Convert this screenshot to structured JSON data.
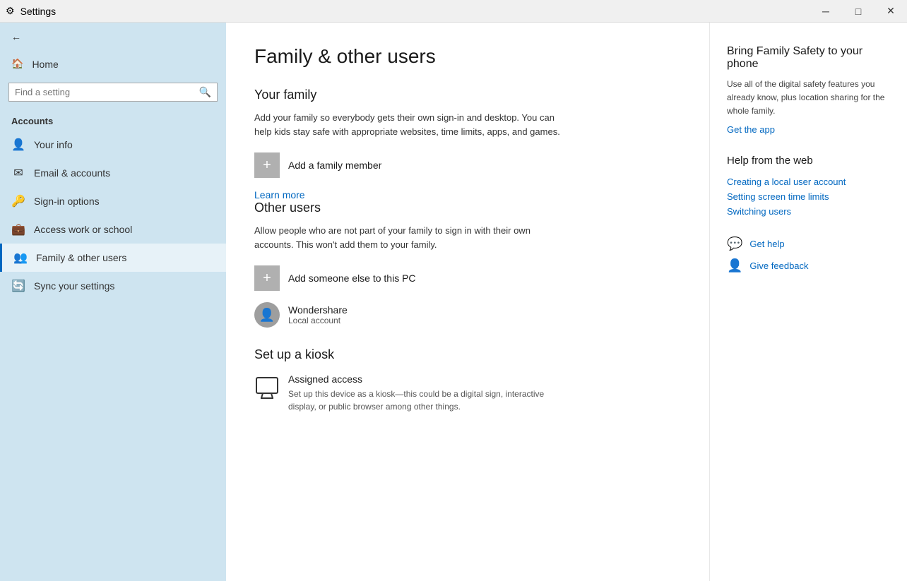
{
  "titlebar": {
    "title": "Settings",
    "min": "─",
    "max": "□",
    "close": "✕"
  },
  "sidebar": {
    "back_label": "Back",
    "home_label": "Home",
    "search_placeholder": "Find a setting",
    "section_label": "Accounts",
    "items": [
      {
        "id": "your-info",
        "label": "Your info",
        "icon": "👤"
      },
      {
        "id": "email-accounts",
        "label": "Email & accounts",
        "icon": "✉"
      },
      {
        "id": "sign-in-options",
        "label": "Sign-in options",
        "icon": "🔑"
      },
      {
        "id": "access-work",
        "label": "Access work or school",
        "icon": "💼"
      },
      {
        "id": "family-other-users",
        "label": "Family & other users",
        "icon": "👥",
        "active": true
      },
      {
        "id": "sync-settings",
        "label": "Sync your settings",
        "icon": "🔄"
      }
    ]
  },
  "main": {
    "page_title": "Family & other users",
    "your_family": {
      "title": "Your family",
      "description": "Add your family so everybody gets their own sign-in and desktop. You can help kids stay safe with appropriate websites, time limits, apps, and games.",
      "add_label": "Add a family member",
      "learn_more": "Learn more"
    },
    "other_users": {
      "title": "Other users",
      "description": "Allow people who are not part of your family to sign in with their own accounts. This won't add them to your family.",
      "add_label": "Add someone else to this PC",
      "users": [
        {
          "name": "Wondershare",
          "type": "Local account"
        }
      ]
    },
    "kiosk": {
      "title": "Set up a kiosk",
      "item_title": "Assigned access",
      "item_desc": "Set up this device as a kiosk—this could be a digital sign, interactive display, or public browser among other things."
    }
  },
  "panel": {
    "promo_title": "Bring Family Safety to your phone",
    "promo_desc": "Use all of the digital safety features you already know, plus location sharing for the whole family.",
    "promo_link": "Get the app",
    "help_title": "Help from the web",
    "links": [
      "Creating a local user account",
      "Setting screen time limits",
      "Switching users"
    ],
    "get_help": "Get help",
    "give_feedback": "Give feedback"
  }
}
